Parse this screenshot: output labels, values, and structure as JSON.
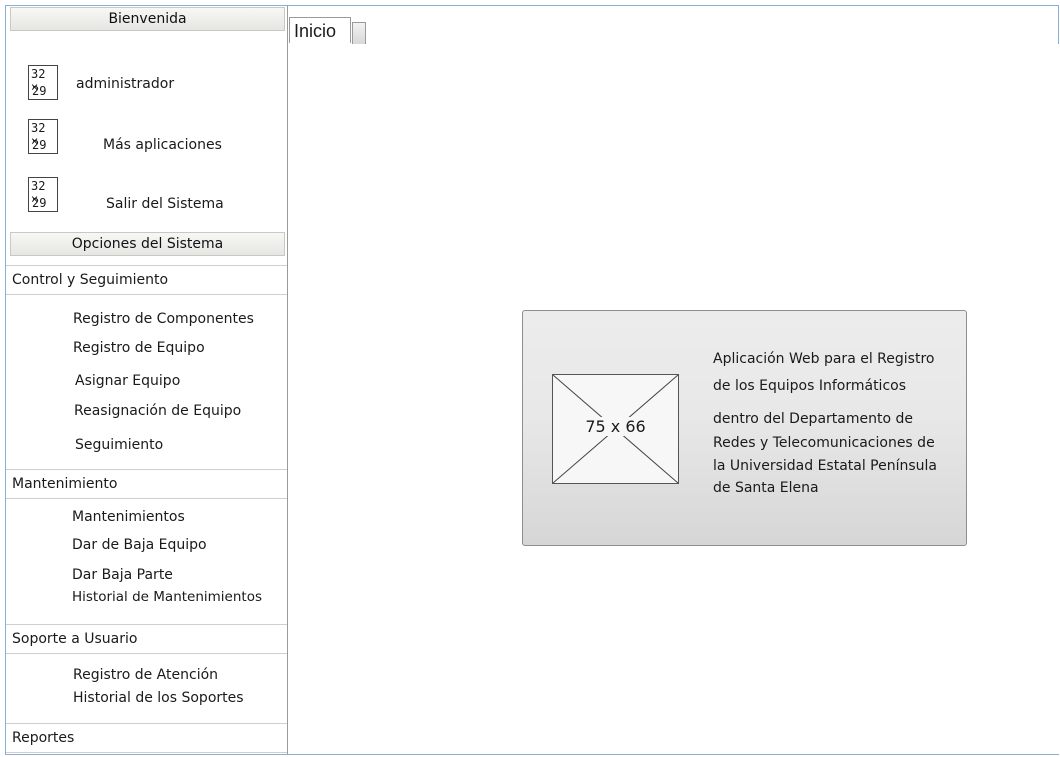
{
  "sidebar": {
    "welcome_header": "Bienvenida",
    "user_menu": [
      {
        "icon_top": "32 ×",
        "icon_bottom": "29",
        "label": "administrador"
      },
      {
        "icon_top": "32 ×",
        "icon_bottom": "29",
        "label": "Más aplicaciones"
      },
      {
        "icon_top": "32 ×",
        "icon_bottom": "29",
        "label": "Salir del Sistema"
      }
    ],
    "options_header": "Opciones del Sistema",
    "sections": {
      "control": {
        "title": "Control y Seguimiento",
        "items": [
          "Registro de Componentes",
          "Registro de Equipo",
          "Asignar Equipo",
          "Reasignación de Equipo",
          "Seguimiento"
        ]
      },
      "mantenimiento": {
        "title": "Mantenimiento",
        "items": [
          "Mantenimientos",
          "Dar de Baja Equipo",
          "Dar Baja Parte",
          "Historial de Mantenimientos"
        ]
      },
      "soporte": {
        "title": "Soporte a Usuario",
        "items": [
          "Registro de Atención",
          "Historial de los Soportes"
        ]
      },
      "reportes": {
        "title": "Reportes"
      }
    }
  },
  "tabs": {
    "active_label": "Inicio"
  },
  "card": {
    "logo_placeholder": "75 x 66",
    "description_lines": [
      "Aplicación Web para el Registro",
      "de los Equipos Informáticos",
      "dentro del Departamento de",
      "Redes y Telecomunicaciones de",
      "la Universidad Estatal Península",
      "de Santa Elena"
    ]
  }
}
